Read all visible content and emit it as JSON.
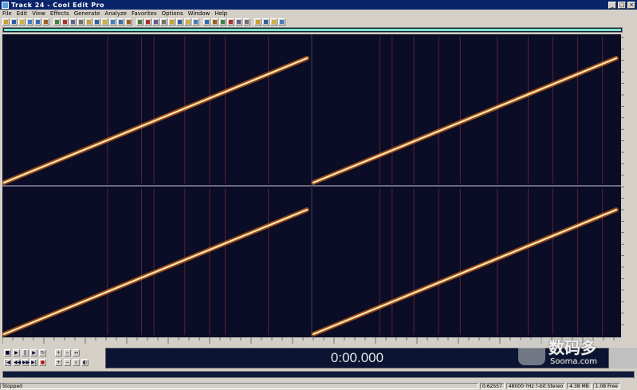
{
  "window": {
    "title": "Track 24 - Cool Edit Pro"
  },
  "menu": [
    "File",
    "Edit",
    "View",
    "Effects",
    "Generate",
    "Analyze",
    "Favorites",
    "Options",
    "Window",
    "Help"
  ],
  "display": {
    "time": "0:00.000"
  },
  "status": {
    "state": "Stopped",
    "sample_info": "48000 ?Hz ?-bit Stereo",
    "size": "4.38 MB",
    "free": "1.08 Free",
    "level": "0.62557"
  },
  "watermark": {
    "text": "数码多",
    "subtext": "Sooma.com"
  },
  "colors": {
    "spectrum_bg": "#0b0c25",
    "sweep": "#ffb060",
    "marker": "#8a3040",
    "divider": "#c8c8e0"
  },
  "toolbar_icons": [
    "open-icon",
    "save-icon",
    "folder-icon",
    "cut-icon",
    "copy-icon",
    "paste-icon",
    "undo-icon",
    "record-icon",
    "zoom-icon",
    "settings-icon"
  ],
  "spectrogram": {
    "rows": 2,
    "columns": 2,
    "sweep": "linear-rising",
    "marker_columns_left": [
      0.34,
      0.45,
      0.49,
      0.59,
      0.67,
      0.72,
      0.86
    ],
    "marker_columns_right": [
      0.22,
      0.26,
      0.33,
      0.41,
      0.48,
      0.6,
      0.7,
      0.78,
      0.86,
      0.94
    ]
  }
}
